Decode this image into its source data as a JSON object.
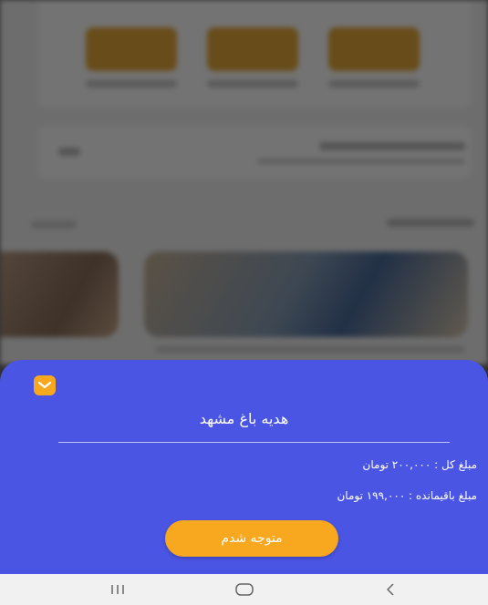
{
  "sheet": {
    "title": "هدیه باغ مشهد",
    "total_amount": "مبلغ کل : ۲۰۰,۰۰۰ تومان",
    "remaining_amount": "مبلغ باقیمانده : ۱۹۹,۰۰۰ تومان",
    "confirm_label": "متوجه شدم",
    "collapse_icon": "chevron-down-icon"
  },
  "navbar": {
    "recents_icon": "recents-icon",
    "home_icon": "home-icon",
    "back_icon": "back-icon"
  },
  "colors": {
    "sheet_bg": "#4a55e4",
    "accent": "#f7a81f",
    "text": "#ffffff",
    "navbar_bg": "#f1f1f1"
  }
}
